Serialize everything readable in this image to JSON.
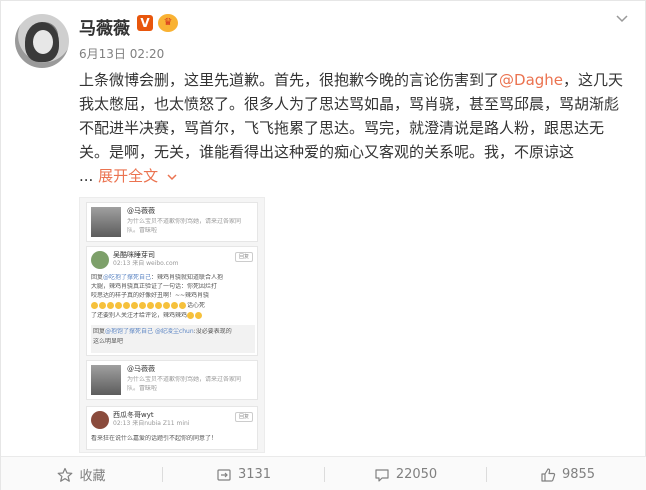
{
  "user": {
    "name": "马薇薇",
    "time": "6月13日 02:20"
  },
  "post": {
    "lead": "上条微博会删，这里先道歉。首先，很抱歉今晚的言论伤害到了",
    "mention": "@Daghe",
    "rest": "，这几天我太憋屈，也太愤怒了。很多人为了思达骂如晶，骂肖骁，甚至骂邱晨，骂胡渐彪不配进半决赛，骂首尔，飞飞拖累了思达。骂完，就澄清说是路人粉，跟思达无关。是啊，无关，谁能看得出这种爱的痴心又客观的关系呢。我，不原谅这",
    "ellipsis": "...",
    "expand_label": "展开全文"
  },
  "screenshot": {
    "card1": {
      "name": "@马薇薇",
      "line1": "为什么宝贝不道歉你别骂她，请来过各家同",
      "line2": "队。冒昧啦"
    },
    "card2": {
      "name": "吴酷咪睡芽司",
      "meta": "02:13 来自 weibo.com",
      "reply_label": "回复",
      "reply_prefix": "回复",
      "reply_mention": "@吃抱了撑死自己",
      "reply_text1": "：辣鸡肖骁就知道联合人抱",
      "reply_text2": "大腿，辣鸡肖骁真正验证了一句话：你死因烂打",
      "reply_text3": "咬思达的样子真的好像好丑啊！~~辣鸡肖骁",
      "reply_text4": "话心死",
      "reply_text5": "了还要别人关注才给评论，辣鸡辣鸡",
      "sub_prefix": "回复",
      "sub_mention1": "@抱饱了撑死自己",
      "sub_mention2": "@纪凌尘chun",
      "sub_text": ":没必要表现的",
      "sub_text2": "这么明显吧"
    },
    "card3": {
      "name": "@马薇薇",
      "line1": "为什么宝贝不道歉你别骂她，请来过各家同",
      "line2": "队。冒昧啦"
    },
    "card4": {
      "name": "西瓜冬哥wyt",
      "meta": "02:13 来自nubia Z11 mini",
      "reply_label": "回复",
      "text": "看来狂在说什么嘉爱的话题引不起你的同意了！"
    }
  },
  "actions": [
    {
      "icon": "star-icon",
      "label": "收藏"
    },
    {
      "icon": "repost-icon",
      "label": "3131"
    },
    {
      "icon": "comment-icon",
      "label": "22050"
    },
    {
      "icon": "thumbs-up-icon",
      "label": "9855"
    }
  ],
  "colors": {
    "accent": "#eb7350",
    "link": "#5d86c4"
  }
}
